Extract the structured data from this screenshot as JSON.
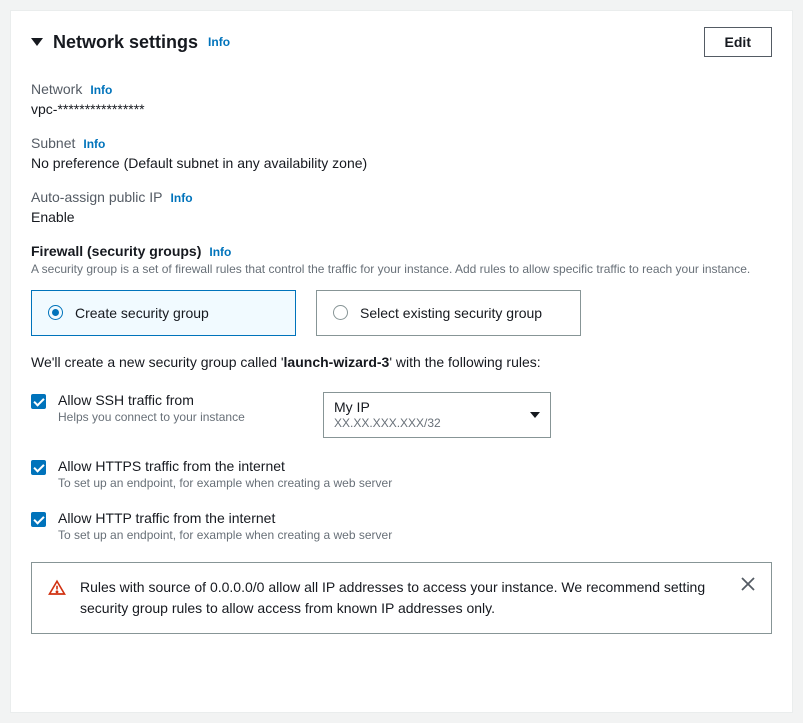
{
  "header": {
    "title": "Network settings",
    "info": "Info",
    "edit": "Edit"
  },
  "network": {
    "label": "Network",
    "info": "Info",
    "value": "vpc-****************"
  },
  "subnet": {
    "label": "Subnet",
    "info": "Info",
    "value": "No preference (Default subnet in any availability zone)"
  },
  "publicIp": {
    "label": "Auto-assign public IP",
    "info": "Info",
    "value": "Enable"
  },
  "firewall": {
    "title": "Firewall (security groups)",
    "info": "Info",
    "desc": "A security group is a set of firewall rules that control the traffic for your instance. Add rules to allow specific traffic to reach your instance.",
    "createLabel": "Create security group",
    "selectLabel": "Select existing security group",
    "notePrefix": "We'll create a new security group called '",
    "noteName": "launch-wizard-3",
    "noteSuffix": "' with the following rules:"
  },
  "ssh": {
    "label": "Allow SSH traffic from",
    "help": "Helps you connect to your instance",
    "selectMain": "My IP",
    "selectSub": "XX.XX.XXX.XXX/32"
  },
  "https": {
    "label": "Allow HTTPS traffic from the internet",
    "help": "To set up an endpoint, for example when creating a web server"
  },
  "http": {
    "label": "Allow HTTP traffic from the internet",
    "help": "To set up an endpoint, for example when creating a web server"
  },
  "alert": {
    "text": "Rules with source of 0.0.0.0/0 allow all IP addresses to access your instance. We recommend setting security group rules to allow access from known IP addresses only."
  }
}
